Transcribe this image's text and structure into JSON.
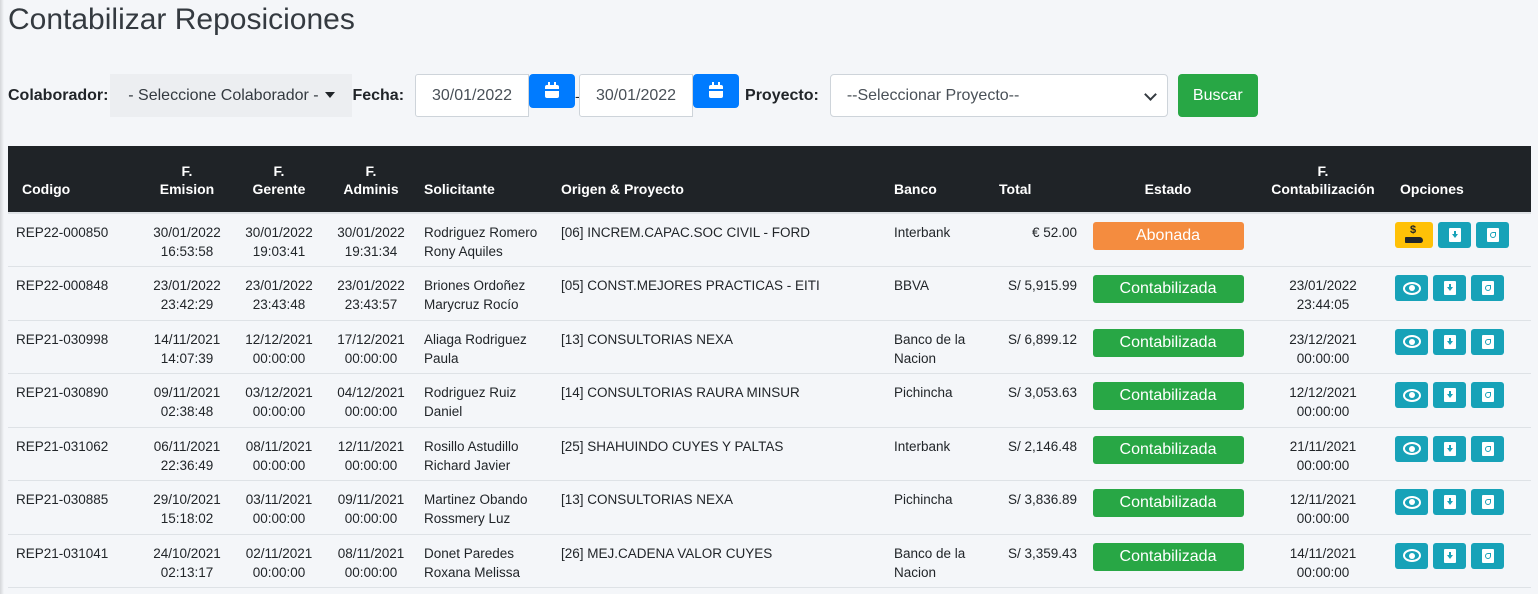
{
  "page": {
    "title": "Contabilizar Reposiciones"
  },
  "filters": {
    "colaborador_label": "Colaborador:",
    "colaborador_value": "- Seleccione Colaborador -",
    "fecha_label": "Fecha:",
    "fecha_desde": "30/01/2022",
    "separator": "-",
    "fecha_hasta": "30/01/2022",
    "proyecto_label": "Proyecto:",
    "proyecto_value": "--Seleccionar Proyecto--",
    "buscar_label": "Buscar"
  },
  "table": {
    "headers": {
      "codigo": "Codigo",
      "f_emision_1": "F.",
      "f_emision_2": "Emision",
      "f_gerente_1": "F.",
      "f_gerente_2": "Gerente",
      "f_adminis_1": "F.",
      "f_adminis_2": "Adminis",
      "solicitante": "Solicitante",
      "origen": "Origen & Proyecto",
      "banco": "Banco",
      "total": "Total",
      "estado": "Estado",
      "f_contab_1": "F.",
      "f_contab_2": "Contabilización",
      "opciones": "Opciones"
    },
    "rows": [
      {
        "codigo": "REP22-000850",
        "emision_d": "30/01/2022",
        "emision_t": "16:53:58",
        "gerente_d": "30/01/2022",
        "gerente_t": "19:03:41",
        "adminis_d": "30/01/2022",
        "adminis_t": "19:31:34",
        "sol_1": "Rodriguez Romero",
        "sol_2": "Rony Aquiles",
        "origen": "[06] INCREM.CAPAC.SOC CIVIL - FORD",
        "banco_1": "Interbank",
        "banco_2": "",
        "total": "€ 52.00",
        "estado": "Abonada",
        "estado_color": "#f48c3f",
        "contab_d": "",
        "contab_t": "",
        "first_action": "pay"
      },
      {
        "codigo": "REP22-000848",
        "emision_d": "23/01/2022",
        "emision_t": "23:42:29",
        "gerente_d": "23/01/2022",
        "gerente_t": "23:43:48",
        "adminis_d": "23/01/2022",
        "adminis_t": "23:43:57",
        "sol_1": "Briones Ordoñez",
        "sol_2": "Marycruz Rocío",
        "origen": "[05] CONST.MEJORES PRACTICAS - EITI",
        "banco_1": "BBVA",
        "banco_2": "",
        "total": "S/ 5,915.99",
        "estado": "Contabilizada",
        "estado_color": "#28a745",
        "contab_d": "23/01/2022",
        "contab_t": "23:44:05",
        "first_action": "view"
      },
      {
        "codigo": "REP21-030998",
        "emision_d": "14/11/2021",
        "emision_t": "14:07:39",
        "gerente_d": "12/12/2021",
        "gerente_t": "00:00:00",
        "adminis_d": "17/12/2021",
        "adminis_t": "00:00:00",
        "sol_1": "Aliaga Rodriguez",
        "sol_2": "Paula",
        "origen": "[13] CONSULTORIAS NEXA",
        "banco_1": "Banco de la",
        "banco_2": "Nacion",
        "total": "S/ 6,899.12",
        "estado": "Contabilizada",
        "estado_color": "#28a745",
        "contab_d": "23/12/2021",
        "contab_t": "00:00:00",
        "first_action": "view"
      },
      {
        "codigo": "REP21-030890",
        "emision_d": "09/11/2021",
        "emision_t": "02:38:48",
        "gerente_d": "03/12/2021",
        "gerente_t": "00:00:00",
        "adminis_d": "04/12/2021",
        "adminis_t": "00:00:00",
        "sol_1": "Rodriguez Ruiz",
        "sol_2": "Daniel",
        "origen": "[14] CONSULTORIAS RAURA MINSUR",
        "banco_1": "Pichincha",
        "banco_2": "",
        "total": "S/ 3,053.63",
        "estado": "Contabilizada",
        "estado_color": "#28a745",
        "contab_d": "12/12/2021",
        "contab_t": "00:00:00",
        "first_action": "view"
      },
      {
        "codigo": "REP21-031062",
        "emision_d": "06/11/2021",
        "emision_t": "22:36:49",
        "gerente_d": "08/11/2021",
        "gerente_t": "00:00:00",
        "adminis_d": "12/11/2021",
        "adminis_t": "00:00:00",
        "sol_1": "Rosillo Astudillo",
        "sol_2": "Richard Javier",
        "origen": "[25] SHAHUINDO CUYES Y PALTAS",
        "banco_1": "Interbank",
        "banco_2": "",
        "total": "S/ 2,146.48",
        "estado": "Contabilizada",
        "estado_color": "#28a745",
        "contab_d": "21/11/2021",
        "contab_t": "00:00:00",
        "first_action": "view"
      },
      {
        "codigo": "REP21-030885",
        "emision_d": "29/10/2021",
        "emision_t": "15:18:02",
        "gerente_d": "03/11/2021",
        "gerente_t": "00:00:00",
        "adminis_d": "09/11/2021",
        "adminis_t": "00:00:00",
        "sol_1": "Martinez Obando",
        "sol_2": "Rossmery Luz",
        "origen": "[13] CONSULTORIAS NEXA",
        "banco_1": "Pichincha",
        "banco_2": "",
        "total": "S/ 3,836.89",
        "estado": "Contabilizada",
        "estado_color": "#28a745",
        "contab_d": "12/11/2021",
        "contab_t": "00:00:00",
        "first_action": "view"
      },
      {
        "codigo": "REP21-031041",
        "emision_d": "24/10/2021",
        "emision_t": "02:13:17",
        "gerente_d": "02/11/2021",
        "gerente_t": "00:00:00",
        "adminis_d": "08/11/2021",
        "adminis_t": "00:00:00",
        "sol_1": "Donet Paredes",
        "sol_2": "Roxana Melissa",
        "origen": "[26] MEJ.CADENA VALOR CUYES",
        "banco_1": "Banco de la",
        "banco_2": "Nacion",
        "total": "S/ 3,359.43",
        "estado": "Contabilizada",
        "estado_color": "#28a745",
        "contab_d": "14/11/2021",
        "contab_t": "00:00:00",
        "first_action": "view"
      }
    ]
  },
  "icons": {
    "calendar": "calendar-icon",
    "view": "eye-icon",
    "download": "file-download-icon",
    "pdf": "file-pdf-icon",
    "pay": "hand-dollar-icon"
  },
  "colors": {
    "primary": "#007bff",
    "success": "#28a745",
    "info": "#17a2b8",
    "warning": "#ffc107",
    "header_bg": "#1f2327"
  }
}
